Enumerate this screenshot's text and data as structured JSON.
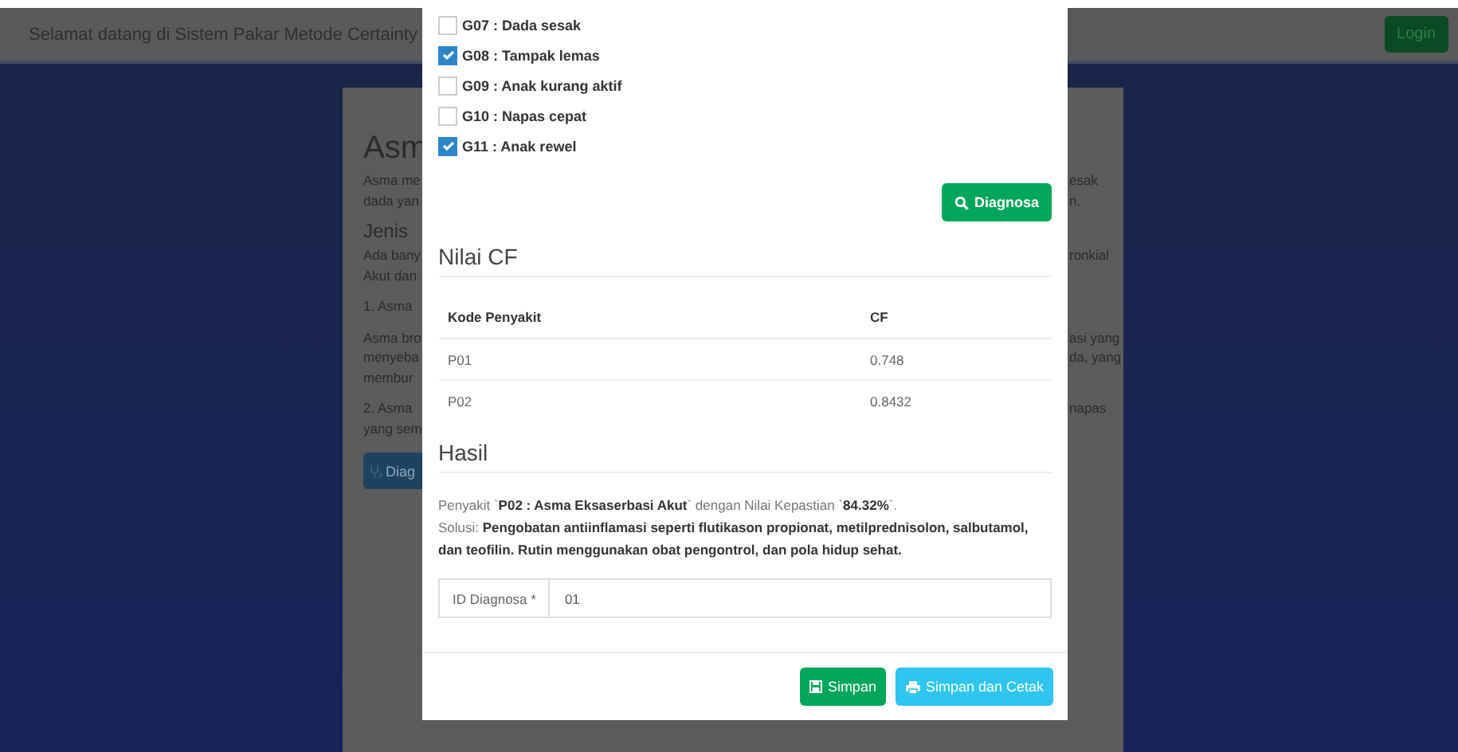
{
  "navbar": {
    "title": "Selamat datang di Sistem Pakar Metode Certainty",
    "login_button": "Login"
  },
  "background_card": {
    "heading": "Asm",
    "button": "Diag",
    "lines": [
      {
        "kind": "text",
        "left": "Asma me",
        "right": "esak"
      },
      {
        "kind": "text",
        "left": "dada yan",
        "right": "n."
      },
      {
        "kind": "subheading",
        "left": "Jenis"
      },
      {
        "kind": "text",
        "left": "Ada bany",
        "right": "ronkial"
      },
      {
        "kind": "text",
        "left": "Akut dan"
      },
      {
        "kind": "gap-text",
        "left": "1. Asma"
      },
      {
        "kind": "gap-text",
        "left": "Asma bro",
        "right": "asi yang"
      },
      {
        "kind": "text",
        "left": "menyeba",
        "right": "da, yang"
      },
      {
        "kind": "text",
        "left": "membur"
      },
      {
        "kind": "gap-text",
        "left": "2. Asma",
        "right": "napas"
      },
      {
        "kind": "text",
        "left": "yang sem"
      }
    ]
  },
  "modal": {
    "symptoms": [
      {
        "label": "G07 : Dada sesak",
        "checked": false
      },
      {
        "label": "G08 : Tampak lemas",
        "checked": true
      },
      {
        "label": "G09 : Anak kurang aktif",
        "checked": false
      },
      {
        "label": "G10 : Napas cepat",
        "checked": false
      },
      {
        "label": "G11 : Anak rewel",
        "checked": true
      }
    ],
    "diagnose_button": "Diagnosa",
    "cf_heading": "Nilai CF",
    "cf_table": {
      "columns": [
        "Kode Penyakit",
        "CF"
      ],
      "rows": [
        [
          "P01",
          "0.748"
        ],
        [
          "P02",
          "0.8432"
        ]
      ]
    },
    "result_heading": "Hasil",
    "result_text": "Penyakit `**P02 : Asma Eksaserbasi Akut**` dengan Nilai Kepastian `**84.32%**`.",
    "solution_text": "Solusi: **Pengobatan antiinflamasi seperti flutikason propionat, metilprednisolon, salbutamol, dan teofilin. Rutin menggunakan obat pengontrol, dan pola hidup sehat.**",
    "id_field": {
      "label": "ID Diagnosa *",
      "value": "01"
    },
    "save_button": "Simpan",
    "save_print_button": "Simpan dan Cetak"
  }
}
